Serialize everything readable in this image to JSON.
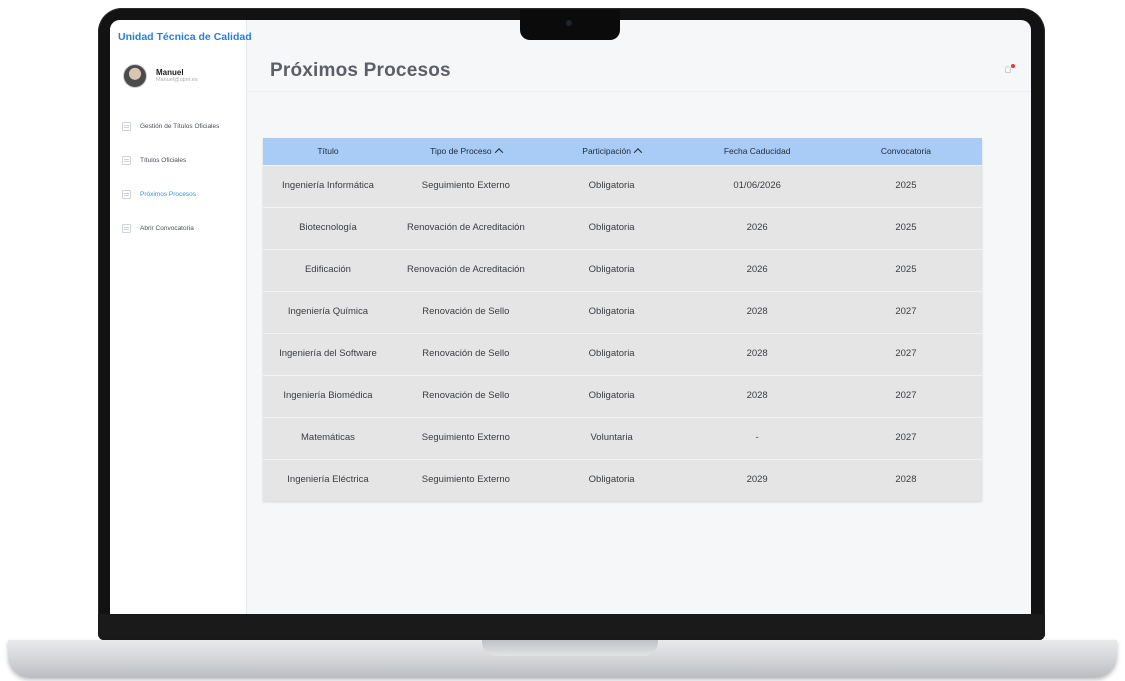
{
  "sidebar": {
    "brand": "Unidad Técnica de Calidad",
    "user": {
      "name": "Manuel",
      "email": "Manuel@upm.es"
    },
    "items": [
      {
        "label": "Gestión de Títulos Oficiales"
      },
      {
        "label": "Títulos Oficiales"
      },
      {
        "label": "Próximos Procesos"
      },
      {
        "label": "Abrir Convocatoria"
      }
    ]
  },
  "main": {
    "title": "Próximos Procesos",
    "table": {
      "headers": [
        "Título",
        "Tipo de Proceso",
        "Participación",
        "Fecha Caducidad",
        "Convocatoria"
      ],
      "rows": [
        [
          "Ingeniería Informática",
          "Seguimiento Externo",
          "Obligatoria",
          "01/06/2026",
          "2025"
        ],
        [
          "Biotecnología",
          "Renovación de Acreditación",
          "Obligatoria",
          "2026",
          "2025"
        ],
        [
          "Edificación",
          "Renovación de Acreditación",
          "Obligatoria",
          "2026",
          "2025"
        ],
        [
          "Ingeniería Química",
          "Renovación de Sello",
          "Obligatoria",
          "2028",
          "2027"
        ],
        [
          "Ingeniería del Software",
          "Renovación de Sello",
          "Obligatoria",
          "2028",
          "2027"
        ],
        [
          "Ingeniería Biomédica",
          "Renovación de Sello",
          "Obligatoria",
          "2028",
          "2027"
        ],
        [
          "Matemáticas",
          "Seguimiento Externo",
          "Voluntaria",
          "-",
          "2027"
        ],
        [
          "Ingeniería Eléctrica",
          "Seguimiento Externo",
          "Obligatoria",
          "2029",
          "2028"
        ]
      ]
    }
  },
  "icons": {
    "sidebar_item": "document-icon",
    "sort": "chevron-up-icon",
    "notification": "bell-icon"
  },
  "colors": {
    "brand": "#2b7dd6",
    "header_bg": "#a8ccf6",
    "row_bg": "#e5e5e5",
    "active_nav": "#3a8ef0",
    "notification_dot": "#e53935"
  }
}
